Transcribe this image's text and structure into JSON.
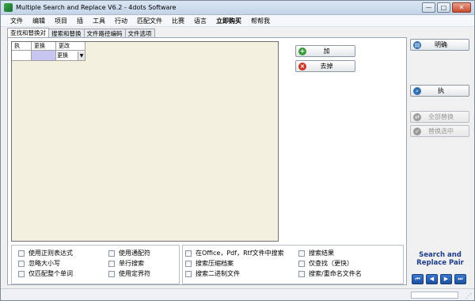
{
  "window": {
    "title": "Multiple Search and Replace V6.2 - 4dots Software",
    "controls": {
      "minimize": "—",
      "maximize": "□",
      "close": "✕"
    }
  },
  "menu": [
    "文件",
    "编辑",
    "项目",
    "插",
    "工具",
    "行动",
    "匹配文件",
    "比赛",
    "语言",
    "立即购买",
    "帮帮我"
  ],
  "tabs": [
    "查找和替换对",
    "搜索和替换",
    "文件路径编码",
    "文件选项"
  ],
  "grid": {
    "headers": [
      "执",
      "更换",
      "更改"
    ],
    "combo_value": "更换",
    "combo_arrow": "▼"
  },
  "buttons": {
    "add": "加",
    "remove": "去掉",
    "ok": "明确",
    "find": "执",
    "replace_all": "全部替换",
    "replace_selected": "替换选中"
  },
  "options": {
    "col1": [
      "使用正则表达式",
      "忽略大小写",
      "仅匹配整个单词"
    ],
    "col2": [
      "使用通配符",
      "单行搜索",
      "使用定界符"
    ],
    "col3": [
      "在Office，Pdf，Rtf文件中搜索",
      "搜索压缩档案",
      "搜索二进制文件"
    ],
    "col4": [
      "搜索结果",
      "仅查找（更快）",
      "搜索/重命名文件名"
    ]
  },
  "sidebar_label": "Search and Replace Pair",
  "nav": [
    "⏮",
    "◀",
    "▶",
    "⏭"
  ],
  "colors": {
    "accent": "#1c3b8a",
    "grid_bg": "#f4f0e0",
    "selected_cell": "#c8c6f0"
  }
}
